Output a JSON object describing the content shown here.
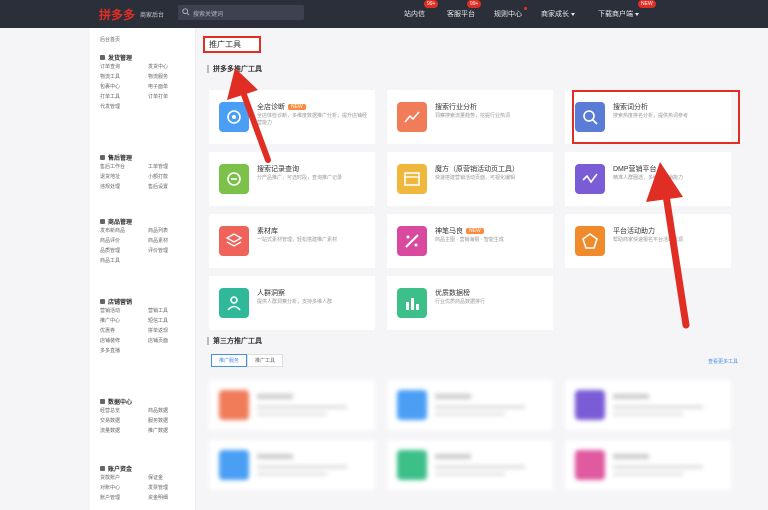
{
  "topbar": {
    "logo": "拼多多",
    "logo_sub": "商家后台",
    "search_placeholder": "搜索关键词",
    "nav": [
      {
        "label": "站内信",
        "badge": "99+"
      },
      {
        "label": "客服平台",
        "badge": "99+"
      },
      {
        "label": "规则中心",
        "dot": true
      },
      {
        "label": "商家成长",
        "caret": true
      },
      {
        "label": "下载商户端",
        "badge": "NEW",
        "caret": true
      }
    ]
  },
  "sidebar": {
    "home": "后台首页",
    "groups": [
      {
        "title": "发货管理",
        "items": [
          "订单查询",
          "发货中心",
          "物流工具",
          "物流服务",
          "包裹中心",
          "电子面单",
          "打单工具",
          "订单打单",
          "代发管理"
        ]
      },
      {
        "title": "售后管理",
        "items": [
          "售后工作台",
          "工单管理",
          "退货地址",
          "小额打款",
          "违规处理",
          "售后设置"
        ]
      },
      {
        "title": "商品管理",
        "items": [
          "发布新商品",
          "商品列表",
          "商品评价",
          "商品素材",
          "品质管理",
          "评价管理",
          "商品工具"
        ]
      },
      {
        "title": "店铺营销",
        "items": [
          "营销活动",
          "营销工具",
          "推广中心",
          "短信工具",
          "优惠券",
          "拼单返现",
          "店铺装修",
          "店铺页面",
          "多多直播"
        ]
      },
      {
        "title": "数据中心",
        "items": [
          "经营总览",
          "商品数据",
          "交易数据",
          "服务数据",
          "流量数据",
          "推广数据"
        ]
      },
      {
        "title": "账户资金",
        "items": [
          "货款账户",
          "保证金",
          "对账中心",
          "发票管理",
          "账户管理",
          "资金明细"
        ]
      }
    ]
  },
  "main": {
    "page_title": "推广工具",
    "section1_title": "拼多多推广工具",
    "tools": [
      {
        "name": "全店诊断",
        "badge": "NEW",
        "desc": "全店体检诊断，多维度数据推广分析，提升店铺经营能力",
        "color": "#4a9ff5"
      },
      {
        "name": "搜索行业分析",
        "desc": "洞察搜索流量趋势，挖掘行业热词",
        "color": "#f07c5a"
      },
      {
        "name": "搜索词分析",
        "desc": "搜索热度排名分析，提供热词参考",
        "color": "#5b7cd6"
      },
      {
        "name": "搜索记录查询",
        "desc": "分产品推广，可选时段，查询推广记录",
        "color": "#7cc24a"
      },
      {
        "name": "魔方（原营销活动页工具）",
        "desc": "快速搭建营销活动页面，可视化编辑",
        "color": "#f0b73d"
      },
      {
        "name": "DMP营销平台",
        "desc": "精准人群圈选，多维度营销能力",
        "color": "#7a5cd6"
      },
      {
        "name": "素材库",
        "desc": "一站式素材管理，轻松搭建推广素材",
        "color": "#f0635a"
      },
      {
        "name": "神笔马良",
        "badge": "NEW",
        "desc": "商品主图 · 营销海报 · 智能生成",
        "color": "#d94a9f"
      },
      {
        "name": "平台活动助力",
        "desc": "帮助商家快速报名平台活动资源",
        "color": "#f08a2b"
      },
      {
        "name": "人群洞察",
        "desc": "提供人群洞察分析，支持多维人群",
        "color": "#2fb89a"
      },
      {
        "name": "优质数据榜",
        "desc": "行业优质商品数据排行",
        "color": "#3dbf8a"
      }
    ],
    "section2_title": "第三方推广工具",
    "tabs": [
      "推广服务",
      "推广工具"
    ],
    "more_link": "查看更多工具",
    "blurred_colors": [
      "#f07c5a",
      "#4a9ff5",
      "#7a5cd6",
      "#4a9ff5",
      "#3dbf8a",
      "#e05aa0"
    ]
  }
}
